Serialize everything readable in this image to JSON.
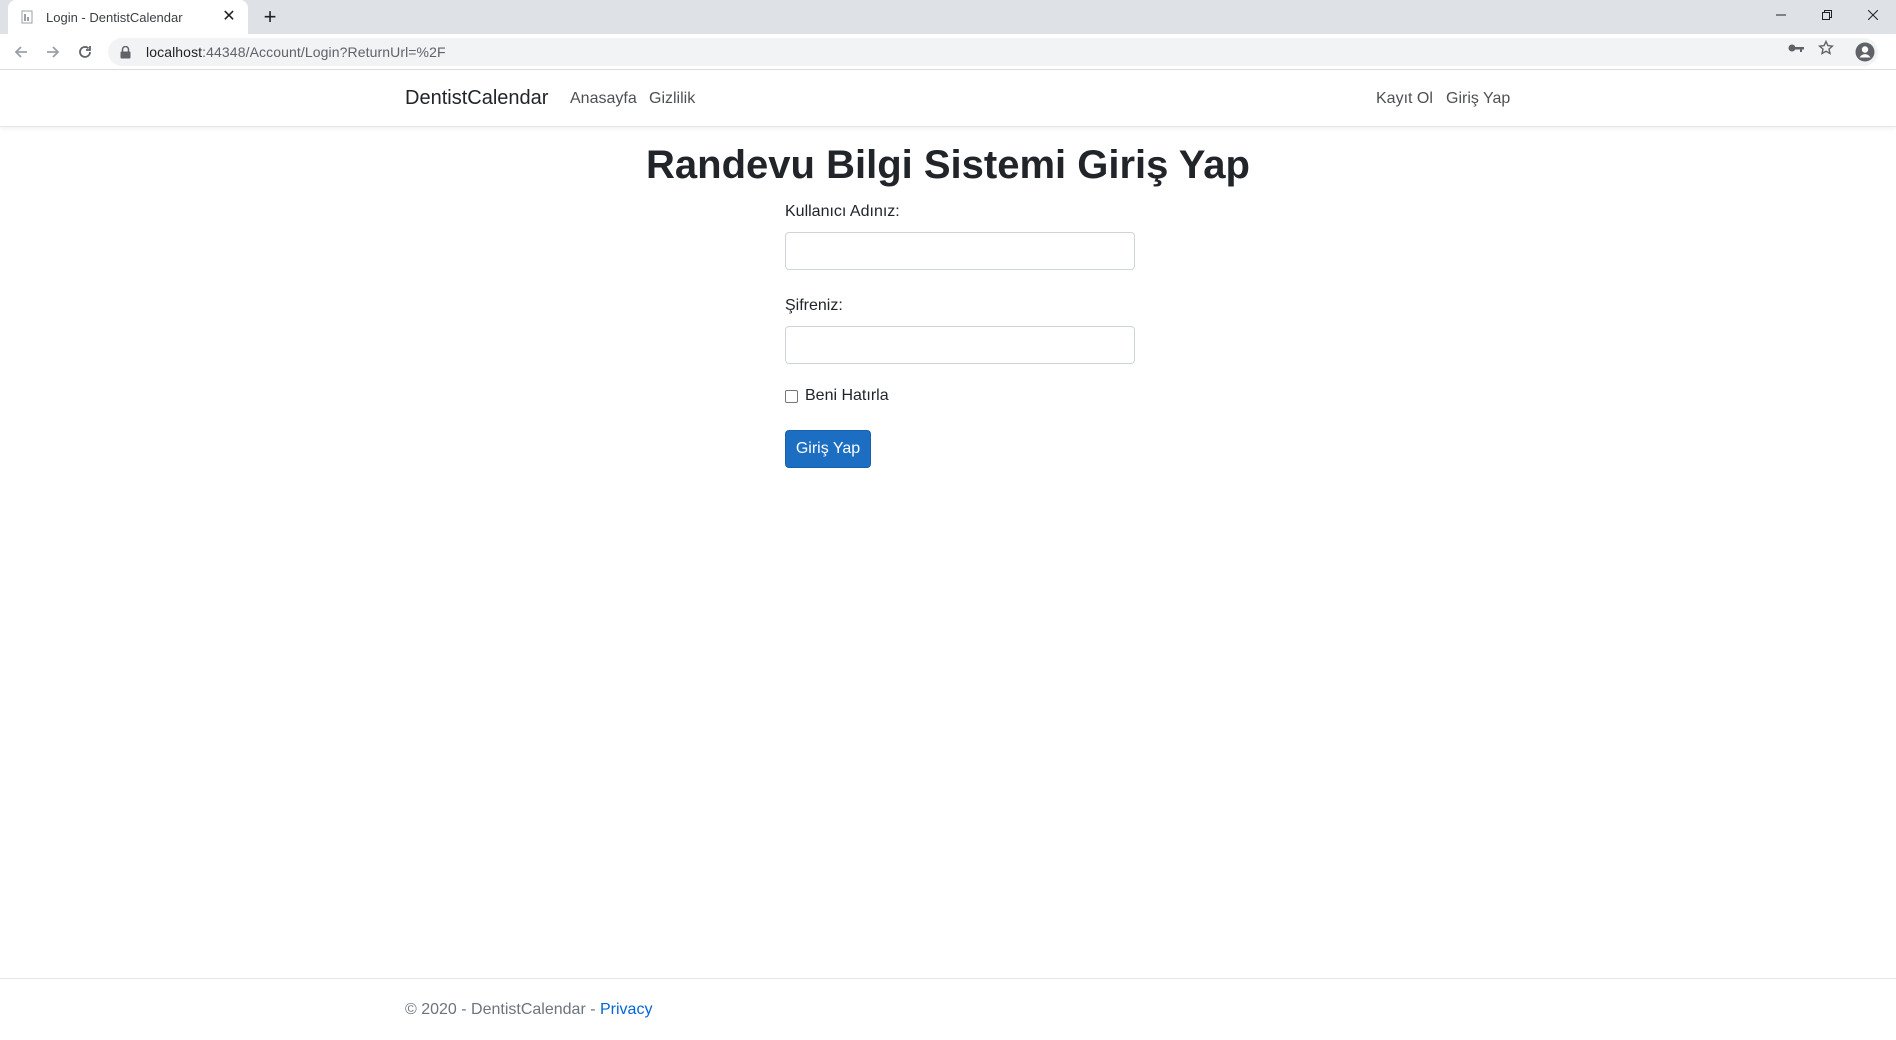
{
  "browser": {
    "tab_title": "Login - DentistCalendar",
    "url_host": "localhost",
    "url_path": ":44348/Account/Login?ReturnUrl=%2F"
  },
  "nav": {
    "brand": "DentistCalendar",
    "links": [
      "Anasayfa",
      "Gizlilik"
    ],
    "right_links": [
      "Kayıt Ol",
      "Giriş Yap"
    ]
  },
  "main": {
    "title": "Randevu Bilgi Sistemi Giriş Yap",
    "username_label": "Kullanıcı Adınız:",
    "username_value": "",
    "password_label": "Şifreniz:",
    "password_value": "",
    "remember_label": "Beni Hatırla",
    "submit_label": "Giriş Yap"
  },
  "footer": {
    "text": "© 2020 - DentistCalendar - ",
    "link": "Privacy"
  },
  "colors": {
    "primary": "#1b6ec2",
    "link": "#0366d6"
  }
}
